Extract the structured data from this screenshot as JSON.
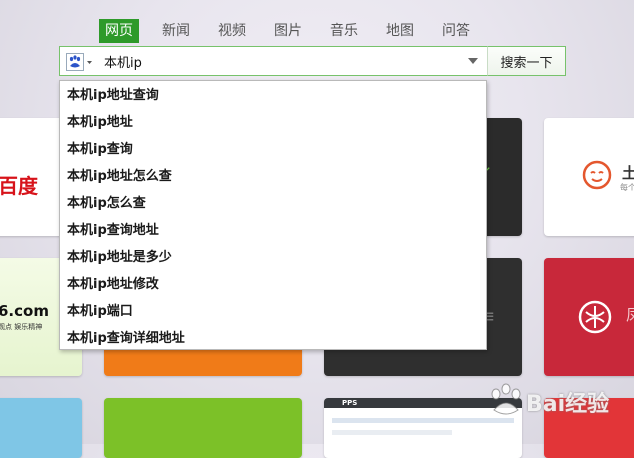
{
  "tabs": [
    {
      "label": "网页",
      "active": true
    },
    {
      "label": "新闻",
      "active": false
    },
    {
      "label": "视频",
      "active": false
    },
    {
      "label": "图片",
      "active": false
    },
    {
      "label": "音乐",
      "active": false
    },
    {
      "label": "地图",
      "active": false
    },
    {
      "label": "问答",
      "active": false
    }
  ],
  "search": {
    "query": "本机ip",
    "engine_icon": "baidu-paw-icon",
    "button_label": "搜索一下"
  },
  "suggestions": [
    "本机ip地址查询",
    "本机ip地址",
    "本机ip查询",
    "本机ip地址怎么查",
    "本机ip怎么查",
    "本机ip查询地址",
    "本机ip地址是多少",
    "本机ip地址修改",
    "本机ip端口",
    "本机ip查询详细地址"
  ],
  "tiles": {
    "baidu": "百度",
    "tudou_name": "土",
    "tudou_sub": "每个",
    "site6_name": "6.com",
    "site6_sub": "观点 娱乐精神",
    "pps_logo": "PPS"
  },
  "watermark": "Bai经验",
  "colors": {
    "active_tab": "#2e9a2a",
    "search_border": "#77c26b",
    "baidu_red": "#d7131a",
    "ifeng_red": "#c8283a"
  }
}
